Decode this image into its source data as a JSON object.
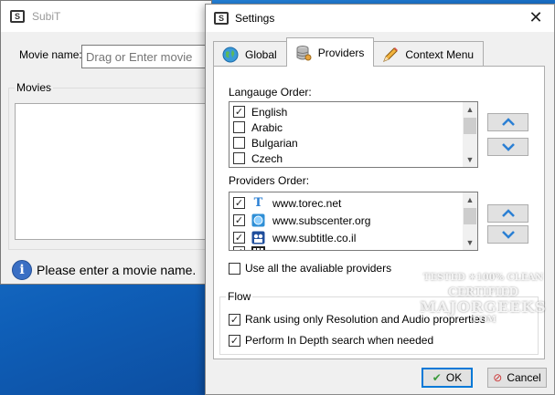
{
  "main_window": {
    "title": "SubiT",
    "movie_name_label": "Movie name:",
    "movie_input_placeholder": "Drag or Enter movie",
    "movies_group_label": "Movies",
    "status_text": "Please enter a movie name."
  },
  "settings": {
    "title": "Settings",
    "close_glyph": "✕",
    "tabs": [
      {
        "label": "Global",
        "active": false,
        "icon": "globe-icon"
      },
      {
        "label": "Providers",
        "active": true,
        "icon": "database-icon"
      },
      {
        "label": "Context Menu",
        "active": false,
        "icon": "pencil-icon"
      }
    ],
    "language_order_label": "Langauge Order:",
    "languages": [
      {
        "name": "English",
        "checked": true
      },
      {
        "name": "Arabic",
        "checked": false
      },
      {
        "name": "Bulgarian",
        "checked": false
      },
      {
        "name": "Czech",
        "checked": false
      }
    ],
    "providers_order_label": "Providers Order:",
    "providers": [
      {
        "name": "www.torec.net",
        "checked": true,
        "icon": "T"
      },
      {
        "name": "www.subscenter.org",
        "checked": true,
        "icon": "globe"
      },
      {
        "name": "www.subtitle.co.il",
        "checked": true,
        "icon": "camera"
      }
    ],
    "use_all_providers_label": "Use all the avaliable providers",
    "use_all_providers_checked": false,
    "flow_group_label": "Flow",
    "rank_option_label": "Rank using only Resolution and Audio proprerties",
    "rank_option_checked": true,
    "depth_option_label": "Perform In Depth search when needed",
    "depth_option_checked": true,
    "ok_label": "OK",
    "cancel_label": "Cancel"
  },
  "watermark": {
    "line1": "TESTED ✶100% CLEAN",
    "line2": "CERTIFIED",
    "line3": "MAJORGEEKS",
    "line4": ".COM"
  },
  "colors": {
    "desktop": "#1d6fc4",
    "accent": "#0078d7",
    "arrow": "#2a7fd4"
  }
}
